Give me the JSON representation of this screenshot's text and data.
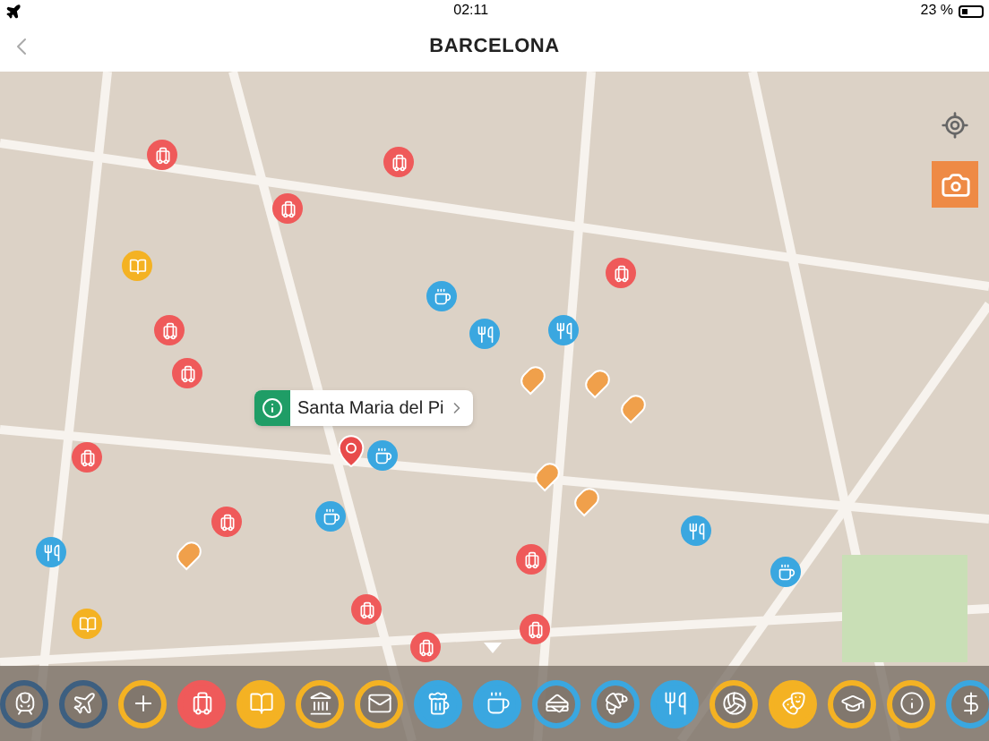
{
  "status_bar": {
    "time": "02:11",
    "battery": "23 %"
  },
  "nav": {
    "title": "BARCELONA"
  },
  "map": {
    "pins": [
      {
        "kind": "luggage",
        "color": "#ef5a5a"
      },
      {
        "kind": "luggage",
        "color": "#ef5a5a"
      },
      {
        "kind": "luggage",
        "color": "#ef5a5a"
      },
      {
        "kind": "luggage",
        "color": "#ef5a5a"
      },
      {
        "kind": "luggage",
        "color": "#ef5a5a"
      },
      {
        "kind": "luggage",
        "color": "#ef5a5a"
      },
      {
        "kind": "luggage",
        "color": "#ef5a5a"
      },
      {
        "kind": "luggage",
        "color": "#ef5a5a"
      },
      {
        "kind": "luggage",
        "color": "#ef5a5a"
      },
      {
        "kind": "luggage",
        "color": "#ef5a5a"
      },
      {
        "kind": "luggage",
        "color": "#ef5a5a"
      },
      {
        "kind": "luggage",
        "color": "#ef5a5a"
      },
      {
        "kind": "coffee",
        "color": "#3aa7e0"
      },
      {
        "kind": "coffee",
        "color": "#3aa7e0"
      },
      {
        "kind": "coffee",
        "color": "#3aa7e0"
      },
      {
        "kind": "coffee",
        "color": "#3aa7e0"
      },
      {
        "kind": "utensils",
        "color": "#3aa7e0"
      },
      {
        "kind": "utensils",
        "color": "#3aa7e0"
      },
      {
        "kind": "utensils",
        "color": "#3aa7e0"
      },
      {
        "kind": "utensils",
        "color": "#3aa7e0"
      },
      {
        "kind": "book",
        "color": "#f4b223"
      },
      {
        "kind": "book",
        "color": "#f4b223"
      },
      {
        "kind": "sight",
        "color": "#f0a04b"
      },
      {
        "kind": "sight",
        "color": "#f0a04b"
      },
      {
        "kind": "sight",
        "color": "#f0a04b"
      },
      {
        "kind": "sight",
        "color": "#f0a04b"
      },
      {
        "kind": "sight",
        "color": "#f0a04b"
      },
      {
        "kind": "sight",
        "color": "#f0a04b"
      }
    ],
    "callout": {
      "label": "Santa Maria del Pi"
    }
  },
  "categories": [
    {
      "kind": "train",
      "color": "#3d5f80",
      "selected": false
    },
    {
      "kind": "plane",
      "color": "#3d5f80",
      "selected": false
    },
    {
      "kind": "plus",
      "color": "#f4b223",
      "selected": false
    },
    {
      "kind": "luggage",
      "color": "#ef5a5a",
      "selected": true
    },
    {
      "kind": "book",
      "color": "#f4b223",
      "selected": true
    },
    {
      "kind": "museum",
      "color": "#f4b223",
      "selected": false
    },
    {
      "kind": "mail",
      "color": "#f4b223",
      "selected": false
    },
    {
      "kind": "beer",
      "color": "#3aa7e0",
      "selected": true
    },
    {
      "kind": "coffee",
      "color": "#3aa7e0",
      "selected": true
    },
    {
      "kind": "burger",
      "color": "#3aa7e0",
      "selected": false
    },
    {
      "kind": "bread",
      "color": "#3aa7e0",
      "selected": false
    },
    {
      "kind": "utensils",
      "color": "#3aa7e0",
      "selected": true
    },
    {
      "kind": "ball",
      "color": "#f4b223",
      "selected": false
    },
    {
      "kind": "theater",
      "color": "#f4b223",
      "selected": true
    },
    {
      "kind": "graduation",
      "color": "#f4b223",
      "selected": false
    },
    {
      "kind": "info",
      "color": "#f4b223",
      "selected": false
    },
    {
      "kind": "money",
      "color": "#3aa7e0",
      "selected": false
    }
  ]
}
